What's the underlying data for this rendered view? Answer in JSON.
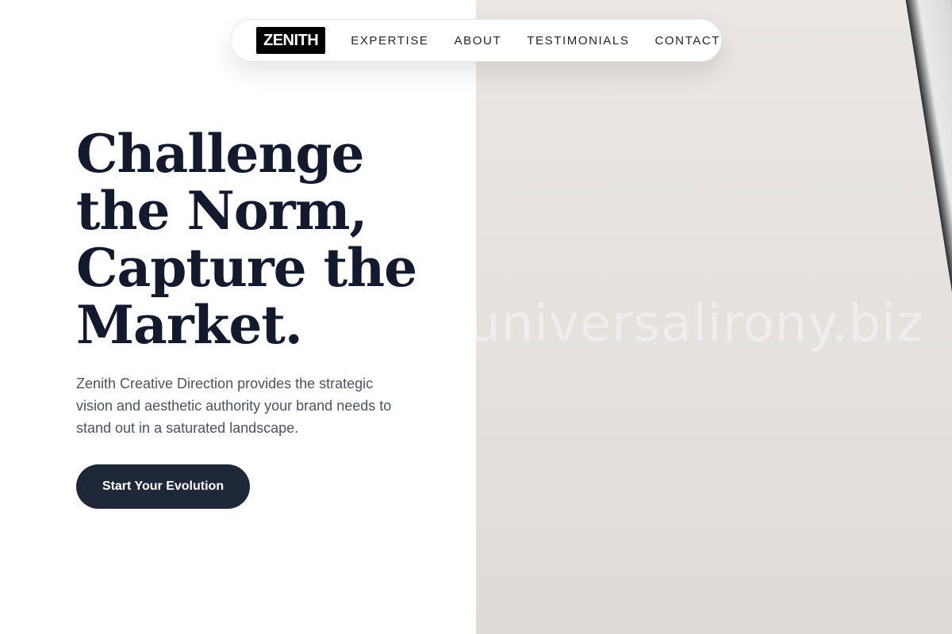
{
  "nav": {
    "logo": "ZENITH",
    "links": [
      "EXPERTISE",
      "ABOUT",
      "TESTIMONIALS",
      "CONTACT"
    ]
  },
  "hero": {
    "headline_lines": [
      "Challenge",
      "the Norm,",
      "Capture the",
      "Market."
    ],
    "subtext": "Zenith Creative Direction provides the strategic vision and aesthetic authority your brand needs to stand out in a saturated landscape.",
    "cta_label": "Start Your Evolution"
  },
  "photo": {
    "watermark": "universalirony.biz"
  },
  "colors": {
    "headline": "#141a2e",
    "cta_background": "#1f2838",
    "logo_background": "#000000",
    "body_text": "#4b5262"
  }
}
